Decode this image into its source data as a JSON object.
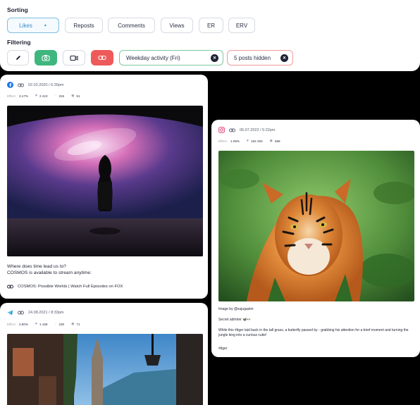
{
  "sorting": {
    "label": "Sorting",
    "options": [
      "Likes",
      "Reposts",
      "Comments",
      "Views",
      "ER",
      "ERV"
    ],
    "active": "Likes"
  },
  "filtering": {
    "label": "Filtering",
    "weekday_chip": "Weekday activity (Fri)",
    "hidden_chip": "5 posts hidden"
  },
  "posts": [
    {
      "platform": "facebook",
      "date": "02.02.2020 / 6:30pm",
      "effect_label": "Effect:",
      "effect": "3.17%",
      "likes": "2 410",
      "comments": "315",
      "views": "51",
      "caption_line1": "Where does time lead us to?",
      "caption_line2": "COSMOS is available to stream anytime:",
      "link_text": "COSMOS: Possible Worlds | Watch Full Episodes on FOX"
    },
    {
      "platform": "telegram",
      "date": "24.08.2021 / 8:33pm",
      "effect_label": "Effect:",
      "effect": "4.80%",
      "likes": "1 169",
      "comments": "230",
      "views": "71"
    },
    {
      "platform": "instagram",
      "date": "06.07.2022 / 5:22pm",
      "effect_label": "Effect:",
      "effect": "1.09%",
      "likes": "182 493",
      "comments": "668",
      "credit": "Image by @sujugasim",
      "secret": "Secret admirer 🦋👀",
      "body": "While this #tiger laid back in the tall grass, a butterfly passed by - grabbing his attention for a brief moment and turning the jungle king into a curious cutie!",
      "tag": "#tiger"
    }
  ],
  "colors": {
    "accent_blue": "#3a8cc6",
    "green": "#3fb67d",
    "red": "#ee5a5a"
  }
}
